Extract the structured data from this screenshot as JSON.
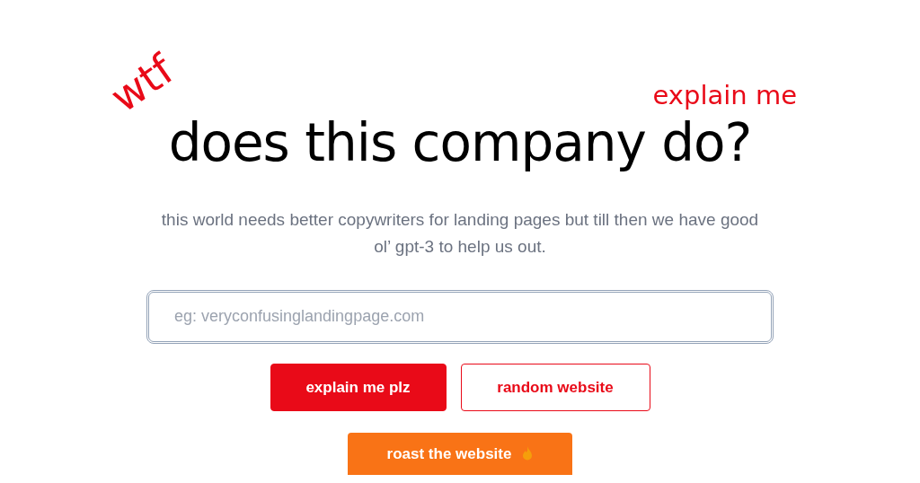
{
  "hero": {
    "tag": "wtf",
    "kicker": "explain me",
    "title": "does this company do?",
    "subtitle": "this world needs better copywriters for landing pages but till then we have good ol’ gpt-3 to help us out."
  },
  "search": {
    "placeholder": "eg: veryconfusinglandingpage.com"
  },
  "buttons": [
    {
      "label": "explain me plz",
      "kind": "primary"
    },
    {
      "label": "random website",
      "kind": "outline"
    },
    {
      "label": "roast the website",
      "kind": "roast"
    }
  ]
}
